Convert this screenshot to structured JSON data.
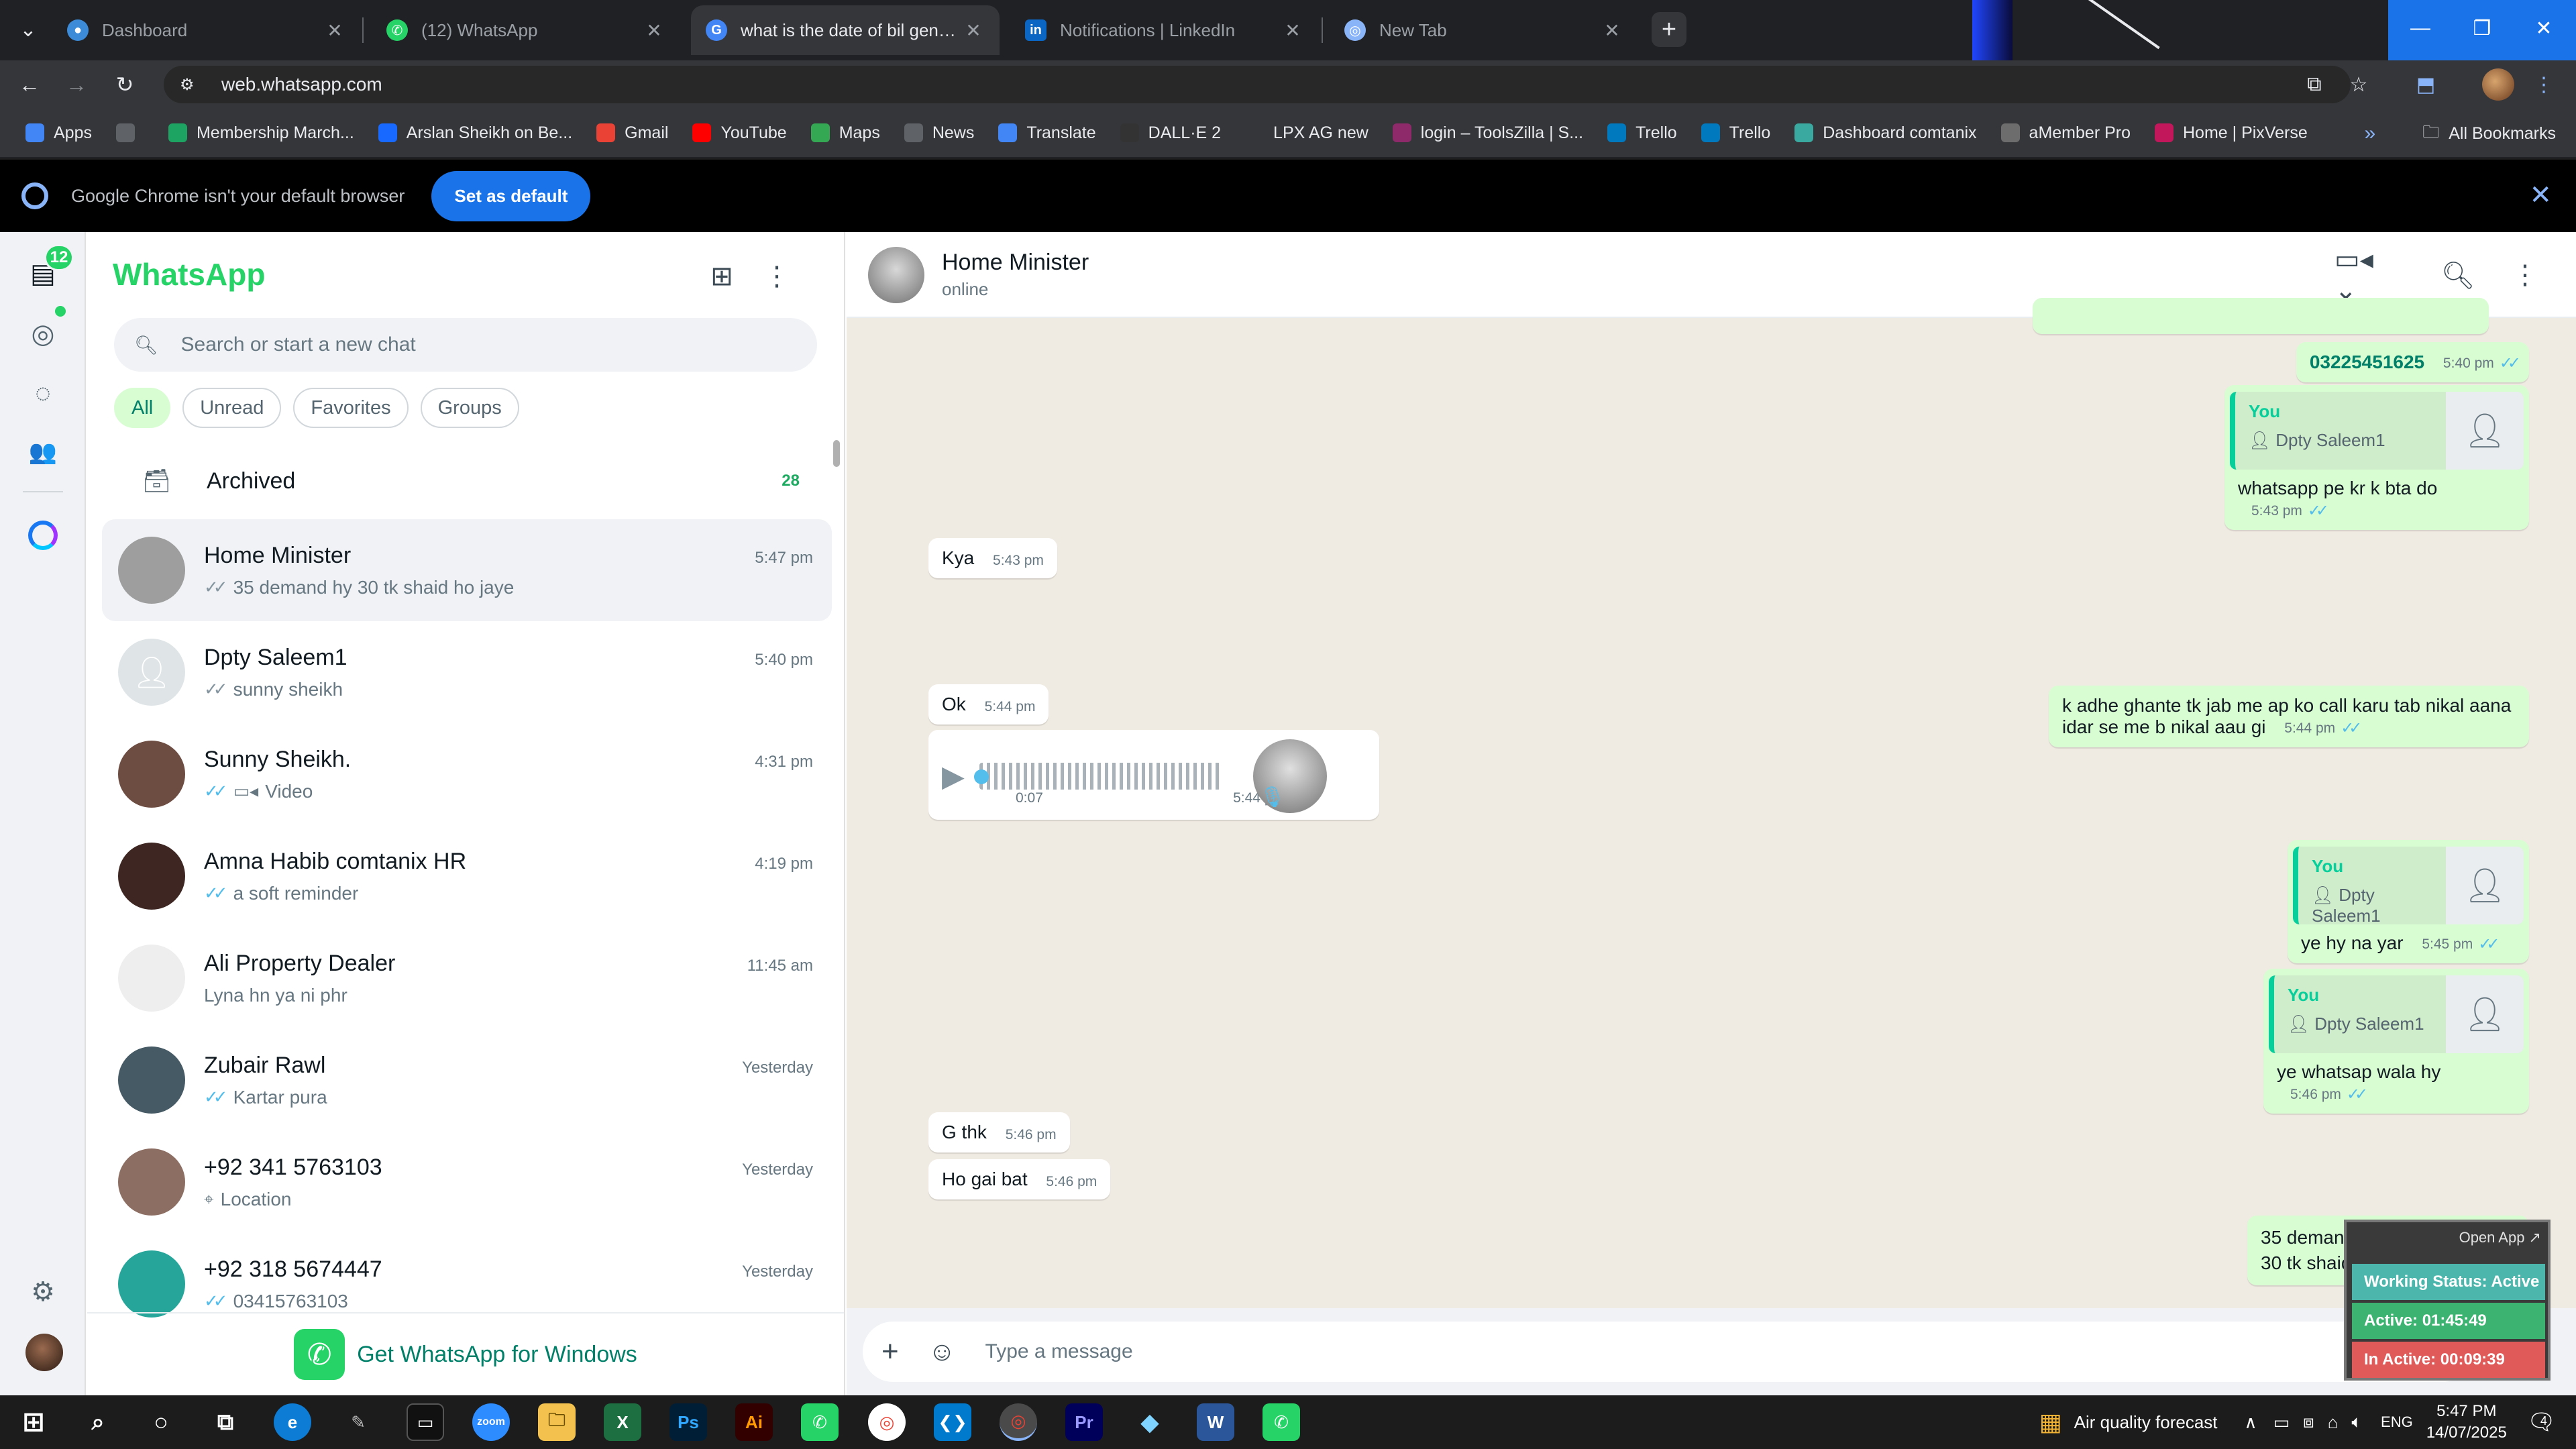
{
  "browser": {
    "tabs": [
      {
        "title": "Dashboard",
        "icon": "globe-icon",
        "color": "#3c8bd9"
      },
      {
        "title": "(12) WhatsApp",
        "icon": "whatsapp-icon",
        "color": "#25d366"
      },
      {
        "title": "what is the date of bil generati...",
        "icon": "google-icon",
        "color": "#4285f4"
      },
      {
        "title": "Notifications | LinkedIn",
        "icon": "linkedin-icon",
        "color": "#0a66c2"
      },
      {
        "title": "New Tab",
        "icon": "chrome-icon",
        "color": "#8ab4f8"
      }
    ],
    "active_tab": 2,
    "url": "web.whatsapp.com",
    "bookmarks": [
      {
        "label": "Apps",
        "color": "#4285f4"
      },
      {
        "label": "",
        "color": "#5f6368"
      },
      {
        "label": "Membership March...",
        "color": "#1da462"
      },
      {
        "label": "Arslan Sheikh on Be...",
        "color": "#1769ff"
      },
      {
        "label": "Gmail",
        "color": "#ea4335"
      },
      {
        "label": "YouTube",
        "color": "#ff0000"
      },
      {
        "label": "Maps",
        "color": "#34a853"
      },
      {
        "label": "News",
        "color": "#5f6368"
      },
      {
        "label": "Translate",
        "color": "#4285f4"
      },
      {
        "label": "DALL·E 2",
        "color": "#333333"
      },
      {
        "label": "LPX AG new",
        "color": "#35363a"
      },
      {
        "label": "login – ToolsZilla | S...",
        "color": "#8e2a6a"
      },
      {
        "label": "Trello",
        "color": "#0079bf"
      },
      {
        "label": "Trello",
        "color": "#0079bf"
      },
      {
        "label": "Dashboard comtanix",
        "color": "#3aa9a0"
      },
      {
        "label": "aMember Pro",
        "color": "#6d6d6d"
      },
      {
        "label": "Home | PixVerse",
        "color": "#c2185b"
      }
    ],
    "all_bookmarks": "All Bookmarks",
    "banner_text": "Google Chrome isn't your default browser",
    "banner_button": "Set as default"
  },
  "whatsapp": {
    "unread_badge": "12",
    "title": "WhatsApp",
    "search_placeholder": "Search or start a new chat",
    "filters": [
      "All",
      "Unread",
      "Favorites",
      "Groups"
    ],
    "archived_label": "Archived",
    "archived_count": "28",
    "chats": [
      {
        "name": "Home Minister",
        "time": "5:47 pm",
        "preview": "35 demand hy  30 tk shaid ho jaye",
        "tick": "grey",
        "avatar_color": "#9e9e9e"
      },
      {
        "name": "Dpty Saleem1",
        "time": "5:40 pm",
        "preview": "sunny sheikh",
        "tick": "grey",
        "avatar_color": "#dfe5e7"
      },
      {
        "name": "Sunny Sheikh.",
        "time": "4:31 pm",
        "preview": "Video",
        "tick": "blue",
        "avatar_color": "#6d4c41"
      },
      {
        "name": "Amna Habib comtanix HR",
        "time": "4:19 pm",
        "preview": "a soft reminder",
        "tick": "blue",
        "avatar_color": "#3e2723"
      },
      {
        "name": "Ali Property Dealer",
        "time": "11:45 am",
        "preview": "Lyna hn ya ni phr",
        "tick": "",
        "avatar_color": "#eeeeee"
      },
      {
        "name": "Zubair Rawl",
        "time": "Yesterday",
        "preview": "Kartar pura",
        "tick": "blue",
        "avatar_color": "#455a64"
      },
      {
        "name": "+92 341 5763103",
        "time": "Yesterday",
        "preview": "Location",
        "tick": "",
        "avatar_color": "#8d6e63"
      },
      {
        "name": "+92 318 5674447",
        "time": "Yesterday",
        "preview": "03415763103",
        "tick": "blue",
        "avatar_color": "#26a69a"
      }
    ],
    "get_windows": "Get WhatsApp for Windows",
    "conversation": {
      "name": "Home Minister",
      "status": "online",
      "messages": {
        "m1": {
          "text": "03225451625",
          "time": "5:40 pm"
        },
        "m2": {
          "author": "You",
          "quote": "Dpty Saleem1",
          "text": "whatsapp pe kr k bta do",
          "time": "5:43 pm"
        },
        "m3": {
          "text": "Kya",
          "time": "5:43 pm"
        },
        "m4": {
          "text": "k adhe ghante tk jab me ap ko call karu tab nikal aana idar se me b nikal aau gi",
          "time": "5:44 pm"
        },
        "m5": {
          "text": "Ok",
          "time": "5:44 pm"
        },
        "m6": {
          "duration": "0:07",
          "time": "5:44 pm"
        },
        "m7": {
          "author": "You",
          "quote": "Dpty Saleem1",
          "text": "ye hy na yar",
          "time": "5:45 pm"
        },
        "m8": {
          "author": "You",
          "quote": "Dpty Saleem1",
          "text": "ye whatsap wala hy",
          "time": "5:46 pm"
        },
        "m9": {
          "text": "G thk",
          "time": "5:46 pm"
        },
        "m10": {
          "text": "Ho gai bat",
          "time": "5:46 pm"
        },
        "m11": {
          "line1": "35 demand hy",
          "line2": "30 tk shaid ho jaye"
        }
      },
      "compose_placeholder": "Type a message"
    }
  },
  "widget": {
    "open_app": "Open App ↗",
    "working_status": "Working Status: Active",
    "active": "Active: 01:45:49",
    "inactive": "In Active: 00:09:39"
  },
  "taskbar": {
    "weather": "Air quality forecast",
    "lang": "ENG",
    "time": "5:47 PM",
    "date": "14/07/2025",
    "notifications": "4"
  }
}
